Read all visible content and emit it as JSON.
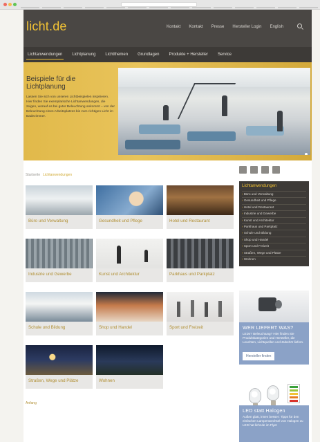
{
  "site": {
    "logo": "licht.de",
    "top_links": [
      "Kontakt",
      "Kontakt",
      "Presse",
      "Hersteller Login",
      "English"
    ],
    "nav": [
      "Lichtanwendungen",
      "Lichtplanung",
      "Lichtthemen",
      "Grundlagen",
      "Produkte + Hersteller",
      "Service"
    ]
  },
  "hero": {
    "title": "Beispiele für die Lichtplanung",
    "body": "Lassen Sie sich von unseren Lichtbeispielen inspirieren. Hier finden Sie exemplarische Lichtanwendungen, die zeigen, worauf es bei guter Beleuchtung ankommt – von der Beleuchtung eines Arbeitsplatzes bis zum richtigen Licht im Badezimmer."
  },
  "breadcrumb": {
    "home": "Startseite",
    "current": "Lichtanwendungen"
  },
  "tiles": [
    {
      "label": "Büro und Verwaltung",
      "icon": "office-photo"
    },
    {
      "label": "Gesundheit und Pflege",
      "icon": "health-photo"
    },
    {
      "label": "Hotel und Restaurant",
      "icon": "hotel-photo"
    },
    {
      "label": "Industrie und Gewerbe",
      "icon": "industry-photo"
    },
    {
      "label": "Kunst und Architektur",
      "icon": "art-photo"
    },
    {
      "label": "Parkhaus und Parkplatz",
      "icon": "parking-photo"
    },
    {
      "label": "Schule und Bildung",
      "icon": "school-photo"
    },
    {
      "label": "Shop und Handel",
      "icon": "shop-photo"
    },
    {
      "label": "Sport und Freizeit",
      "icon": "sport-photo"
    },
    {
      "label": "Straßen, Wege und Plätze",
      "icon": "street-photo"
    },
    {
      "label": "Wohnen",
      "icon": "living-photo"
    }
  ],
  "sidebar": {
    "title": "Lichtanwendungen",
    "items": [
      "Büro und Verwaltung",
      "Gesundheit und Pflege",
      "Hotel und Restaurant",
      "Industrie und Gewerbe",
      "Kunst und Architektur",
      "Parkhaus und Parkplatz",
      "Schule und Bildung",
      "Shop und Handel",
      "Sport und Freizeit",
      "Straßen, Wege und Plätze",
      "Wohnen"
    ],
    "promo1": {
      "title": "WER LIEFERT WAS?",
      "body": "LEDs? Beleuchtung? Hier finden Sie Produktkategorien und Hersteller, die Leuchten, Lichtquellen und Zubehör liefern.",
      "button": "Hersteller finden"
    },
    "promo2": {
      "title": "LED statt Halogen",
      "body": "Außen glatt, innen besser: Tipps für den einfachen Lampenwechsel von Halogen zu LED hat licht.de im Flyer"
    }
  },
  "footer": {
    "link": "Anfang"
  },
  "colors": {
    "accent": "#f2c335",
    "header_bg": "#4a4744",
    "promo_bg": "#8ba2c7"
  }
}
